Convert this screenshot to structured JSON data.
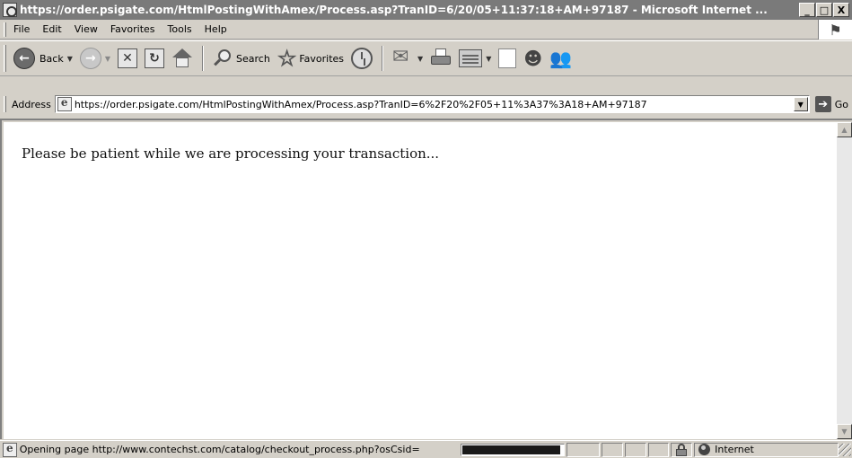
{
  "window": {
    "title": "https://order.psigate.com/HtmlPostingWithAmex/Process.asp?TranID=6/20/05+11:37:18+AM+97187 - Microsoft Internet ...",
    "controls": {
      "minimize": "_",
      "maximize": "□",
      "close": "X"
    }
  },
  "menu": {
    "items": [
      "File",
      "Edit",
      "View",
      "Favorites",
      "Tools",
      "Help"
    ]
  },
  "toolbar": {
    "back_label": "Back",
    "search_label": "Search",
    "favorites_label": "Favorites"
  },
  "address": {
    "label": "Address",
    "url": "https://order.psigate.com/HtmlPostingWithAmex/Process.asp?TranID=6%2F20%2F05+11%3A37%3A18+AM+97187",
    "go_label": "Go"
  },
  "content": {
    "message": "Please be patient while we are processing your transaction..."
  },
  "status": {
    "text": "Opening page http://www.contechst.com/catalog/checkout_process.php?osCsid=",
    "progress_fraction": 0.97,
    "zone": "Internet"
  },
  "colors": {
    "chrome": "#d4d0c8",
    "titlebar": "#7a7a7a",
    "content_bg": "#ffffff"
  }
}
